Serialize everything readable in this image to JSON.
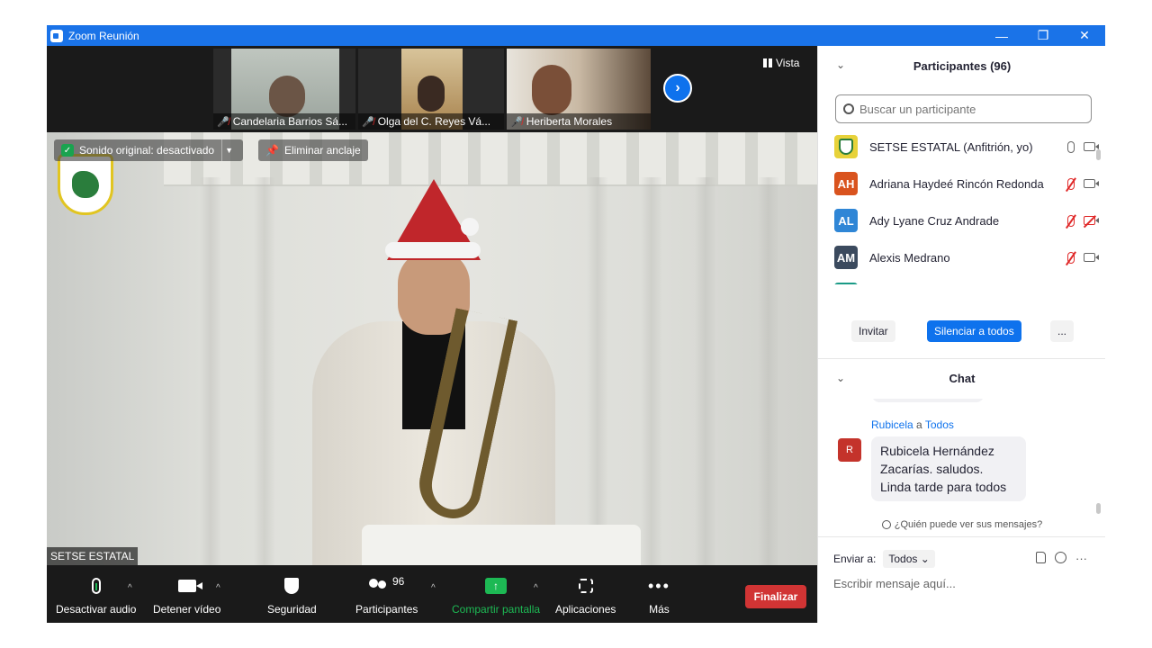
{
  "window": {
    "title": "Zoom Reunión",
    "min_label": "—",
    "restore_label": "❐",
    "close_label": "✕"
  },
  "thumbnails": [
    {
      "name": "Candelaria Barrios Sá...",
      "muted": true
    },
    {
      "name": "Olga del C. Reyes Vá...",
      "muted": true
    },
    {
      "name": "Heriberta Morales",
      "muted": true
    }
  ],
  "view_button": "Vista",
  "next_arrow": "›",
  "main_video": {
    "original_sound": "Sonido original: desactivado",
    "unpin": "Eliminar anclaje",
    "speaker_name": "SETSE ESTATAL"
  },
  "toolbar": {
    "audio_label": "Desactivar audio",
    "video_label": "Detener vídeo",
    "security_label": "Seguridad",
    "participants_label": "Participantes",
    "participants_count": "96",
    "share_label": "Compartir pantalla",
    "apps_label": "Aplicaciones",
    "more_label": "Más",
    "end_label": "Finalizar",
    "caret": "^",
    "more_glyph": "•••"
  },
  "participants_panel": {
    "title": "Participantes (96)",
    "collapse_glyph": "⌄",
    "search_placeholder": "Buscar un participante",
    "items": [
      {
        "initials": "",
        "name": "SETSE ESTATAL (Anfitrión, yo)",
        "color": "#e7d23a",
        "mic": "on",
        "cam": "on"
      },
      {
        "initials": "AH",
        "name": "Adriana Haydeé Rincón Redonda",
        "color": "#d9531e",
        "mic": "off",
        "cam": "on"
      },
      {
        "initials": "AL",
        "name": "Ady Lyane Cruz Andrade",
        "color": "#2f86d6",
        "mic": "off",
        "cam": "off"
      },
      {
        "initials": "AM",
        "name": "Alexis Medrano",
        "color": "#3b4a5e",
        "mic": "off",
        "cam": "on"
      }
    ],
    "invite": "Invitar",
    "mute_all": "Silenciar a todos",
    "more": "..."
  },
  "chat_panel": {
    "title": "Chat",
    "collapse_glyph": "⌄",
    "sender": "Rubicela",
    "to_word": "a",
    "recipient": "Todos",
    "avatar_letter": "R",
    "message": "Rubicela Hernández Zacarías.  saludos. Linda tarde para todos",
    "who_sees": "¿Quién puede ver sus mensajes?",
    "send_to_label": "Enviar a:",
    "send_to_value": "Todos ⌄",
    "input_placeholder": "Escribir mensaje aquí...",
    "more_glyph": "···"
  },
  "colors": {
    "accent": "#0e72ed",
    "titlebar": "#1a73e8",
    "end_red": "#d13434",
    "share_green": "#1db954"
  }
}
